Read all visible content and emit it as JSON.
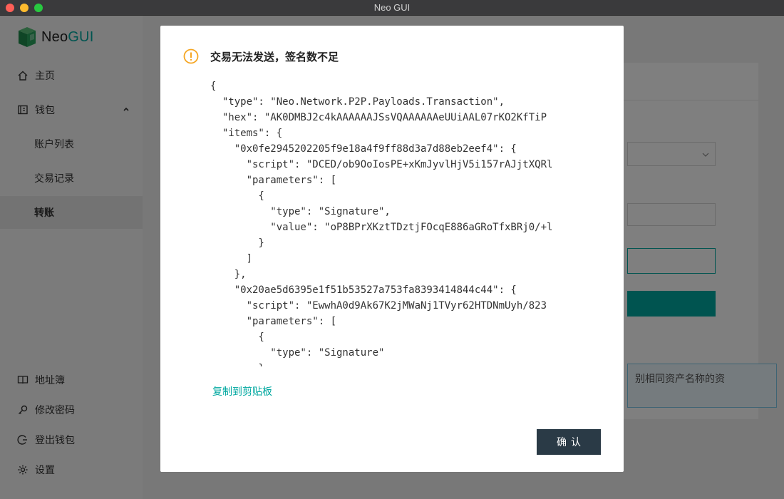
{
  "window": {
    "title": "Neo GUI"
  },
  "logo": {
    "neo": "Neo",
    "gui": "GUI"
  },
  "sidebar": {
    "items": [
      {
        "label": "主页"
      },
      {
        "label": "钱包"
      },
      {
        "label": "账户列表"
      },
      {
        "label": "交易记录"
      },
      {
        "label": "转账"
      }
    ],
    "bottom": [
      {
        "label": "地址簿"
      },
      {
        "label": "修改密码"
      },
      {
        "label": "登出钱包"
      },
      {
        "label": "设置"
      }
    ]
  },
  "background": {
    "hint": "别相同资产名称的资"
  },
  "modal": {
    "title": "交易无法发送，签名数不足",
    "json_lines": [
      "{",
      "  \"type\": \"Neo.Network.P2P.Payloads.Transaction\",",
      "  \"hex\": \"AK0DMBJ2c4kAAAAAAJSsVQAAAAAAeUUiAAL07rKO2KfTiP",
      "  \"items\": {",
      "    \"0x0fe2945202205f9e18a4f9ff88d3a7d88eb2eef4\": {",
      "      \"script\": \"DCED/ob9OoIosPE+xKmJyvlHjV5i157rAJjtXQRl",
      "      \"parameters\": [",
      "        {",
      "          \"type\": \"Signature\",",
      "          \"value\": \"oP8BPrXKztTDztjFOcqE886aGRoTfxBRj0/+l",
      "        }",
      "      ]",
      "    },",
      "    \"0x20ae5d6395e1f51b53527a753fa8393414844c44\": {",
      "      \"script\": \"EwwhA0d9Ak67K2jMWaNj1TVyr62HTDNmUyh/823",
      "      \"parameters\": [",
      "        {",
      "          \"type\": \"Signature\"",
      "        }"
    ],
    "copy_label": "复制到剪贴板",
    "confirm_label": "确认"
  },
  "colors": {
    "accent": "#00a8a0",
    "warning": "#f5a623",
    "confirm_bg": "#2a3a46"
  }
}
